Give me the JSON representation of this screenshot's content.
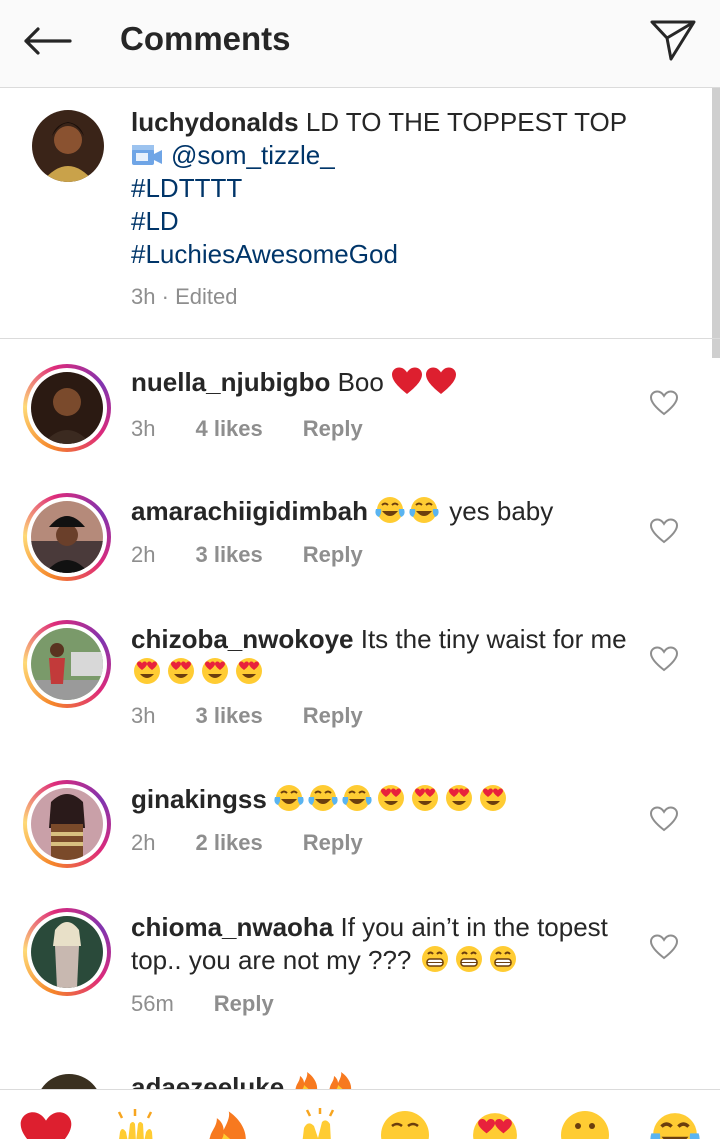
{
  "header": {
    "title": "Comments",
    "back_icon": "arrow-left-icon",
    "share_icon": "send-icon"
  },
  "caption": {
    "username": "luchydonalds",
    "text": "LD TO THE TOPPEST TOP",
    "mention": "@som_tizzle_",
    "hashtags": [
      "#LDTTTT",
      "#LD",
      "#LuchiesAwesomeGod"
    ],
    "time": "3h",
    "edited": "Edited",
    "separator": "·"
  },
  "comments": [
    {
      "username": "nuella_njubigbo",
      "text": "Boo",
      "emojis": [
        "red-heart",
        "red-heart"
      ],
      "time": "3h",
      "likes": "4 likes",
      "reply": "Reply"
    },
    {
      "username": "amarachiigidimbah",
      "text_after_emoji": "yes baby",
      "emojis": [
        "tears-of-joy",
        "tears-of-joy"
      ],
      "time": "2h",
      "likes": "3 likes",
      "reply": "Reply"
    },
    {
      "username": "chizoba_nwokoye",
      "text": "Its the tiny waist for me",
      "emojis": [
        "heart-eyes",
        "heart-eyes",
        "heart-eyes",
        "heart-eyes"
      ],
      "time": "3h",
      "likes": "3 likes",
      "reply": "Reply"
    },
    {
      "username": "ginakingss",
      "emojis": [
        "tears-of-joy",
        "tears-of-joy",
        "tears-of-joy",
        "heart-eyes",
        "heart-eyes",
        "heart-eyes",
        "heart-eyes"
      ],
      "time": "2h",
      "likes": "2 likes",
      "reply": "Reply"
    },
    {
      "username": "chioma_nwaoha",
      "text": "If you ain’t in the topest top.. you are not my ???",
      "emojis": [
        "grin",
        "grin",
        "grin"
      ],
      "time": "56m",
      "reply": "Reply"
    },
    {
      "username": "adaezeeluke",
      "emojis": [
        "fire",
        "fire"
      ]
    }
  ],
  "emoji_bar": [
    "red-heart",
    "raising-hands",
    "fire",
    "clapping-hands",
    "crying-face",
    "heart-eyes",
    "astonished-face",
    "tears-of-joy"
  ],
  "colors": {
    "link": "#003569",
    "meta": "#8e8e8e",
    "text": "#262626",
    "divider": "#dbdbdb"
  }
}
